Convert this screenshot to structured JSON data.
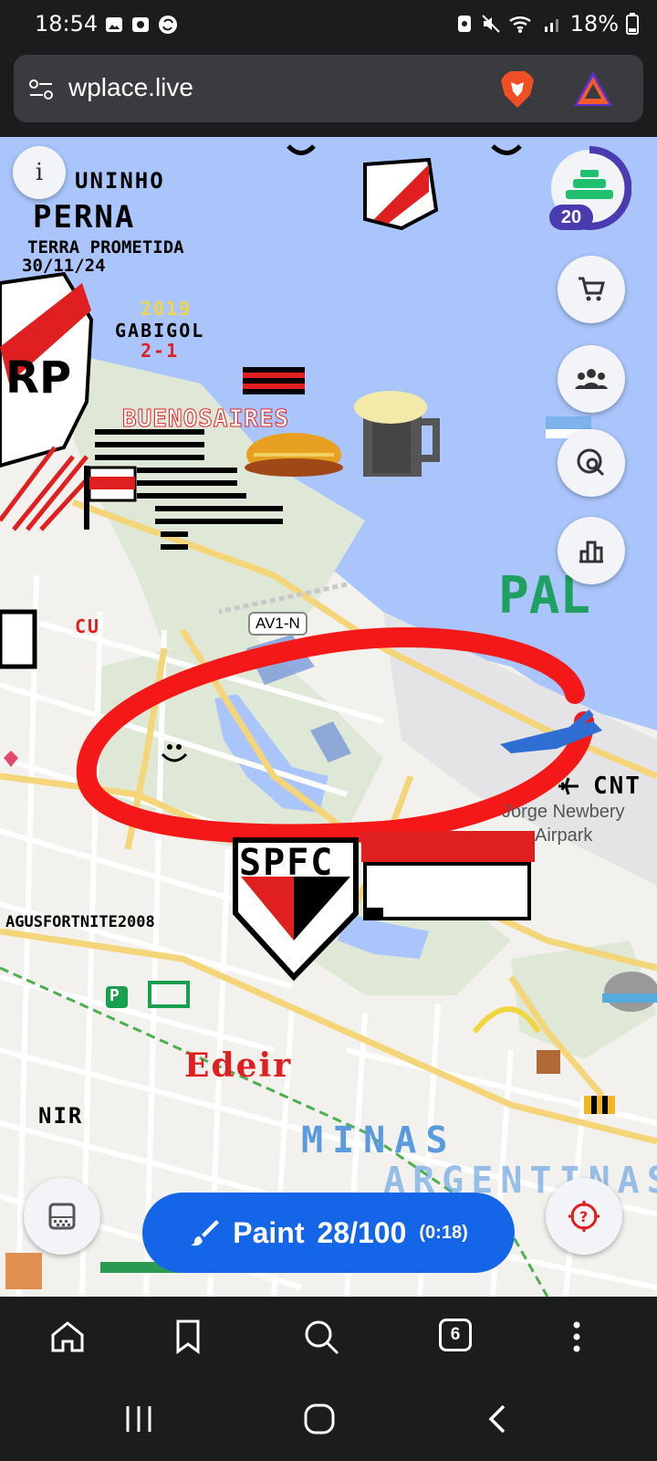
{
  "status": {
    "time": "18:54",
    "battery": "18%"
  },
  "browser": {
    "url": "wplace.live",
    "tab_count": "6"
  },
  "map": {
    "road_label": "AV1-N",
    "airport_name_line1": "Jorge Newbery",
    "airport_name_line2": "Airpark",
    "airport_code": "CNT",
    "art_texts": {
      "ninho": "UNINHO",
      "perna": "PERNA",
      "terra": "TERRA PROMETIDA",
      "date": "30/11/24",
      "year": "2019",
      "gabigol": "GABIGOL",
      "score": "2-1",
      "buenos": "BUENOSAIRES",
      "pal": "PAL",
      "cu": "CU",
      "spfc": "SPFC",
      "agus": "AGUSFORTNITE2008",
      "edeir": "Edeir",
      "nir": "NIR",
      "minas": "MINAS",
      "argentinas": "ARGENTINAS",
      "p": "P"
    }
  },
  "controls": {
    "info_label": "i",
    "level": "20",
    "paint_label": "Paint",
    "paint_count": "28/100",
    "paint_timer": "(0:18)"
  },
  "icons": [
    "info-icon",
    "level-avatar-icon",
    "cart-icon",
    "group-icon",
    "search-globe-icon",
    "leaderboard-icon",
    "palette-icon",
    "brush-icon",
    "help-target-icon",
    "home-icon",
    "bookmark-icon",
    "search-icon",
    "tabs-icon",
    "more-icon",
    "recents-icon",
    "home-circle-icon",
    "back-icon"
  ]
}
